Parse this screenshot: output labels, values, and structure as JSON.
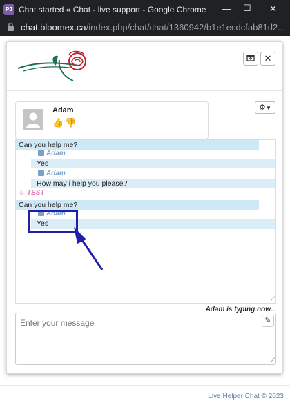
{
  "window": {
    "app_icon_label": "PJ",
    "title": "Chat started « Chat - live support - Google Chrome",
    "url_host": "chat.bloomex.ca",
    "url_path": "/index.php/chat/chat/1360942/b1e1ecdcfab81d2..."
  },
  "header": {
    "logo": "rose-logo",
    "popout_icon": "popout-icon",
    "close_glyph": "✕"
  },
  "operator": {
    "name": "Adam"
  },
  "messages": [
    {
      "kind": "visitor",
      "text": "Can you help me?"
    },
    {
      "kind": "sender",
      "name": "Adam"
    },
    {
      "kind": "operator",
      "text": "Yes"
    },
    {
      "kind": "sender",
      "name": "Adam"
    },
    {
      "kind": "operator",
      "text": "How may i help you please?"
    },
    {
      "kind": "system",
      "name": "TEST"
    },
    {
      "kind": "visitor",
      "text": "Can you help me?"
    },
    {
      "kind": "sender",
      "name": "Adam"
    },
    {
      "kind": "operator",
      "text": "Yes"
    }
  ],
  "status": {
    "typing": "Adam is typing now..."
  },
  "composer": {
    "placeholder": "Enter your message"
  },
  "footer": {
    "credit": "Live Helper Chat © 2023"
  },
  "colors": {
    "visitor_bg": "#cfe8f6",
    "operator_bg": "#dbeef8",
    "sender_color": "#7ca1c7",
    "system_color": "#e17bb8",
    "annotation_color": "#1f1faa"
  }
}
